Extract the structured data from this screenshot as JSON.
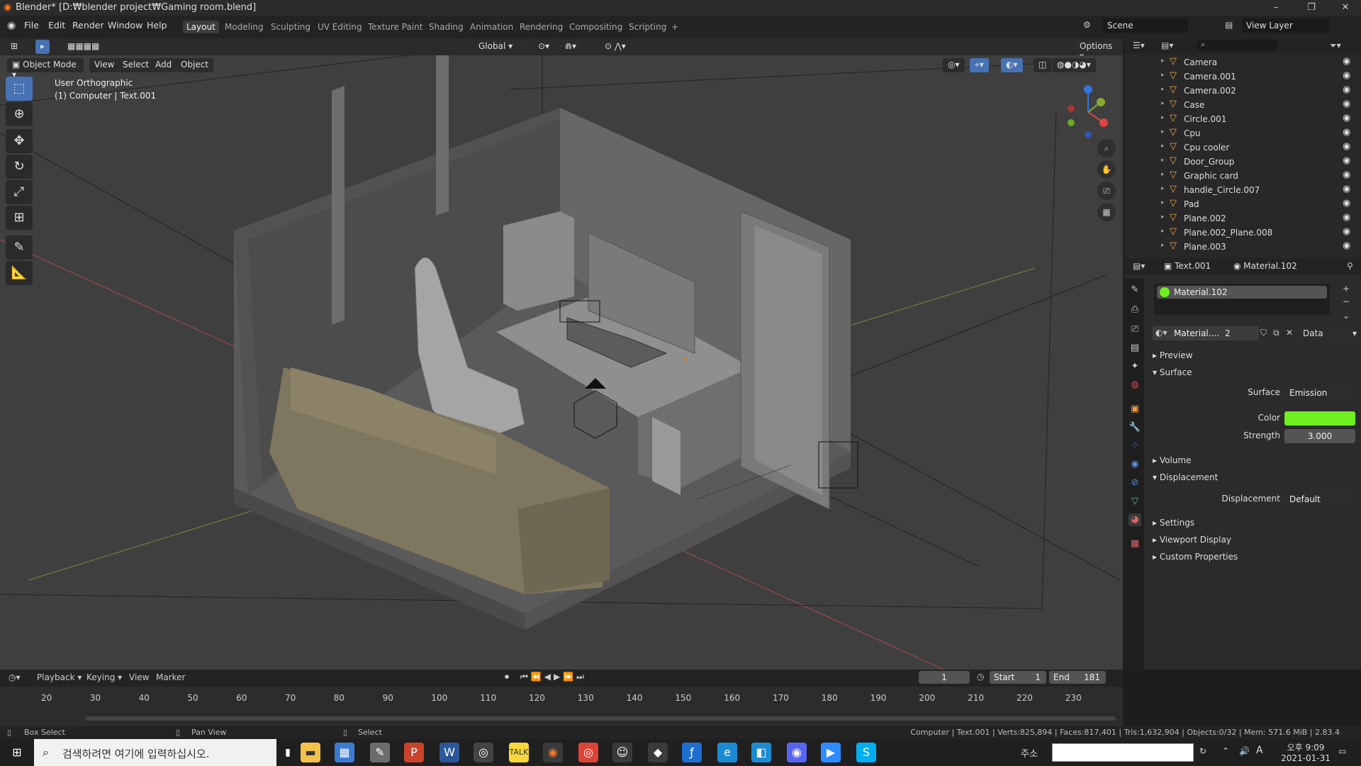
{
  "window": {
    "title": "Blender* [D:₩blender project₩Gaming room.blend]",
    "min": "–",
    "max": "❐",
    "close": "✕"
  },
  "menus": [
    "File",
    "Edit",
    "Render",
    "Window",
    "Help"
  ],
  "workspaces": [
    "Layout",
    "Modeling",
    "Sculpting",
    "UV Editing",
    "Texture Paint",
    "Shading",
    "Animation",
    "Rendering",
    "Compositing",
    "Scripting",
    "+"
  ],
  "scene": {
    "name": "Scene",
    "view_layer": "View Layer"
  },
  "viewport_header": {
    "transform": "Global",
    "options": "Options",
    "mode": "Object Mode",
    "menus": [
      "View",
      "Select",
      "Add",
      "Object"
    ]
  },
  "viewport_overlay": {
    "view_name": "User Orthographic",
    "context": "(1) Computer | Text.001"
  },
  "outliner": {
    "search_placeholder": "",
    "items": [
      {
        "name": "Camera"
      },
      {
        "name": "Camera.001"
      },
      {
        "name": "Camera.002"
      },
      {
        "name": "Case"
      },
      {
        "name": "Circle.001"
      },
      {
        "name": "Cpu"
      },
      {
        "name": "Cpu cooler"
      },
      {
        "name": "Door_Group"
      },
      {
        "name": "Graphic card"
      },
      {
        "name": "handle_Circle.007"
      },
      {
        "name": "Pad"
      },
      {
        "name": "Plane.002"
      },
      {
        "name": "Plane.002_Plane.008"
      },
      {
        "name": "Plane.003"
      }
    ]
  },
  "properties": {
    "object": "Text.001",
    "material": "Material.102",
    "slot": "Material.102",
    "mat_name": "Material....",
    "users": "2",
    "link": "Data",
    "sections": {
      "preview": "Preview",
      "surface": "Surface",
      "volume": "Volume",
      "displacement": "Displacement",
      "settings": "Settings",
      "viewport_display": "Viewport Display",
      "custom_properties": "Custom Properties"
    },
    "surface_label": "Surface",
    "surface_value": "Emission",
    "color_label": "Color",
    "color_value": "#6ef01f",
    "strength_label": "Strength",
    "strength_value": "3.000",
    "disp_label": "Displacement",
    "disp_value": "Default"
  },
  "timeline": {
    "menus": [
      "Playback",
      "Keying",
      "View",
      "Marker"
    ],
    "current": "1",
    "start_label": "Start",
    "start": "1",
    "end_label": "End",
    "end": "181",
    "ticks": [
      "20",
      "30",
      "40",
      "50",
      "60",
      "70",
      "80",
      "90",
      "100",
      "110",
      "120",
      "130",
      "140",
      "150",
      "160",
      "170",
      "180",
      "190",
      "200",
      "210",
      "220",
      "230"
    ]
  },
  "status": {
    "box_select": "Box Select",
    "pan_view": "Pan View",
    "select": "Select",
    "stats": "Computer | Text.001 | Verts:825,894 | Faces:817,401 | Tris:1,632,904 | Objects:0/32 | Mem: 571.6 MiB | 2.83.4"
  },
  "taskbar": {
    "search_placeholder": "검색하려면 여기에 입력하십시오.",
    "address_label": "주소",
    "time": "오후 9:09",
    "date": "2021-01-31",
    "lang": "A"
  }
}
